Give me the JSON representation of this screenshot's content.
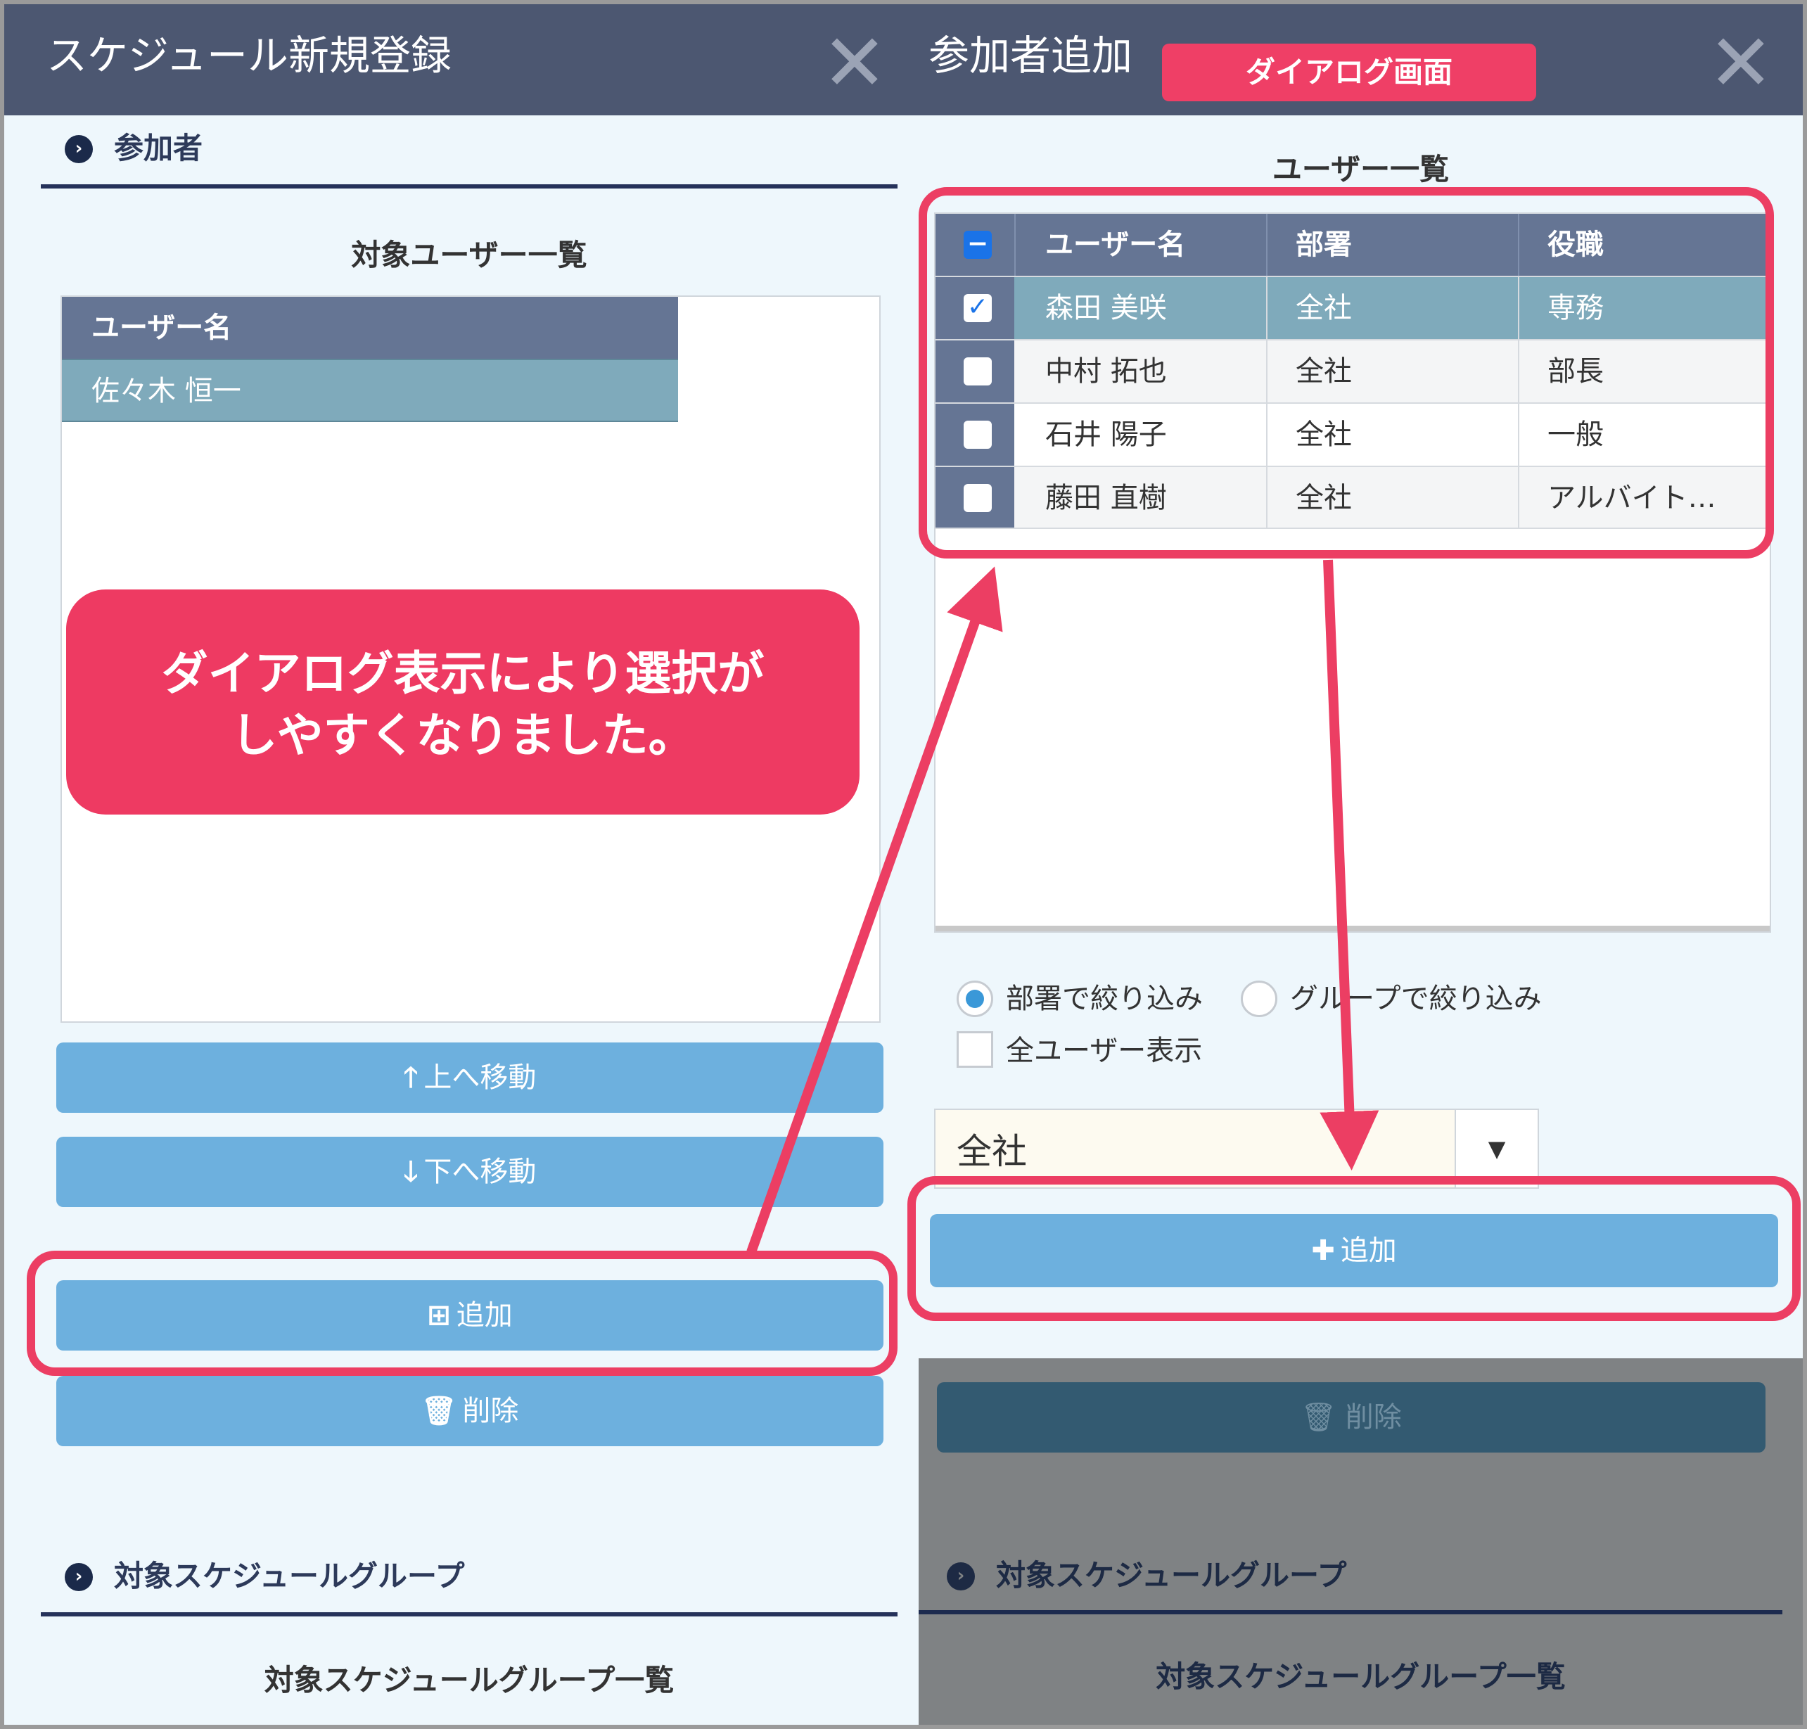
{
  "left_dialog": {
    "title": "スケジュール新規登録",
    "close_glyph": "✕",
    "participants_section": "参加者",
    "user_list_title": "対象ユーザー一覧",
    "user_list_header": "ユーザー名",
    "user_list_rows": [
      "佐々木 恒一"
    ],
    "move_up_label": "上へ移動",
    "move_down_label": "下へ移動",
    "add_label": "追加",
    "delete_label": "削除",
    "group_section": "対象スケジュールグループ",
    "group_list_title": "対象スケジュールグループ一覧"
  },
  "callout": {
    "line1": "ダイアログ表示により選択が",
    "line2": "しやすくなりました。"
  },
  "right_dialog": {
    "title": "参加者追加",
    "badge": "ダイアログ画面",
    "close_glyph": "✕",
    "user_list_title": "ユーザー一覧",
    "columns": [
      "ユーザー名",
      "部署",
      "役職"
    ],
    "rows": [
      {
        "name": "森田 美咲",
        "dept": "全社",
        "role": "専務",
        "checked": true
      },
      {
        "name": "中村 拓也",
        "dept": "全社",
        "role": "部長",
        "checked": false
      },
      {
        "name": "石井 陽子",
        "dept": "全社",
        "role": "一般",
        "checked": false
      },
      {
        "name": "藤田 直樹",
        "dept": "全社",
        "role": "アルバイト…",
        "checked": false
      }
    ],
    "filter_dept_label": "部署で絞り込み",
    "filter_group_label": "グループで絞り込み",
    "show_all_label": "全ユーザー表示",
    "select_value": "全社",
    "select_arrow": "▼",
    "add_label": "追加",
    "delete_label": "削除",
    "group_section": "対象スケジュールグループ",
    "group_list_title": "対象スケジュールグループ一覧"
  },
  "colors": {
    "accent_pink": "#ec3e63",
    "header_navy": "#4c5771",
    "button_blue": "#6db0de",
    "selected_row": "#7faabb"
  },
  "icons": {
    "section_bullet": "chevron-circle-right-icon",
    "move_up": "arrow-up-icon",
    "move_down": "arrow-down-icon",
    "add_left": "plus-square-icon",
    "add_right": "plus-icon",
    "delete": "trash-icon",
    "close": "close-icon"
  }
}
